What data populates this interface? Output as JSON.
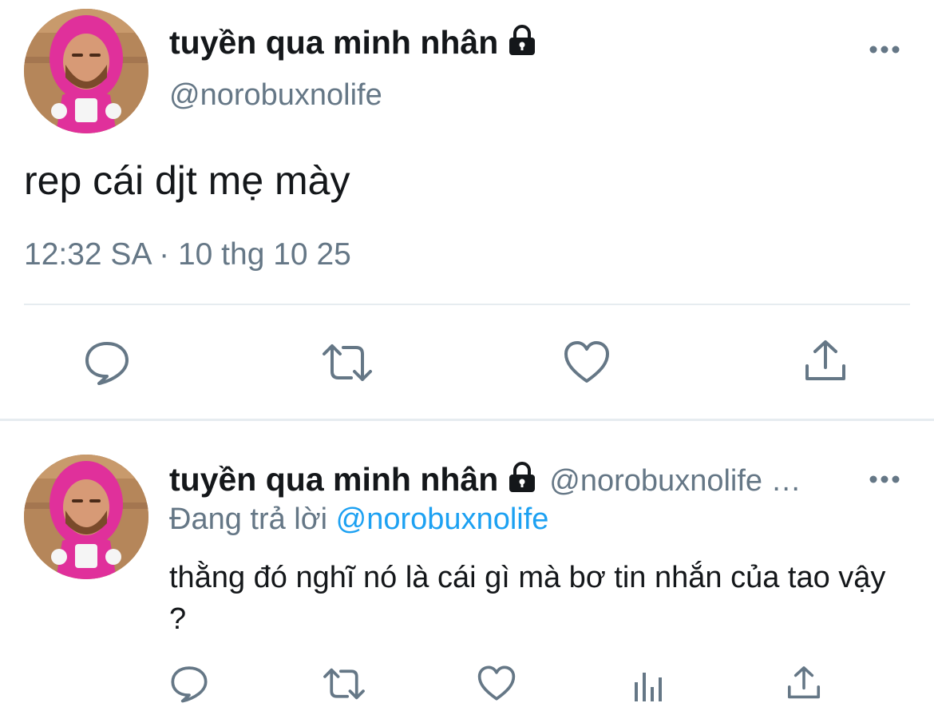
{
  "main_tweet": {
    "display_name": "tuyền qua minh nhân",
    "handle": "@norobuxnolife",
    "text": "rep cái djt mẹ mày",
    "timestamp": "12:32 SA · 10 thg 10 25",
    "icons": [
      "lock-icon",
      "more-icon",
      "reply-icon",
      "retweet-icon",
      "like-icon",
      "share-icon"
    ]
  },
  "reply_tweet": {
    "display_name": "tuyền qua minh nhân",
    "handle": "@norobuxnolife …",
    "replying_label": "Đang trả lời",
    "replying_mention": "@norobuxnolife",
    "text": "thằng đó nghĩ nó là cái gì mà bơ tin nhắn của tao vậy ?",
    "icons": [
      "lock-icon",
      "more-icon",
      "reply-icon",
      "retweet-icon",
      "like-icon",
      "stats-icon",
      "share-icon"
    ]
  },
  "colors": {
    "text_primary": "#14171a",
    "text_secondary": "#657786",
    "link": "#1da1f2",
    "divider": "#e6ecf0",
    "avatar_hood": "#e0309b"
  }
}
